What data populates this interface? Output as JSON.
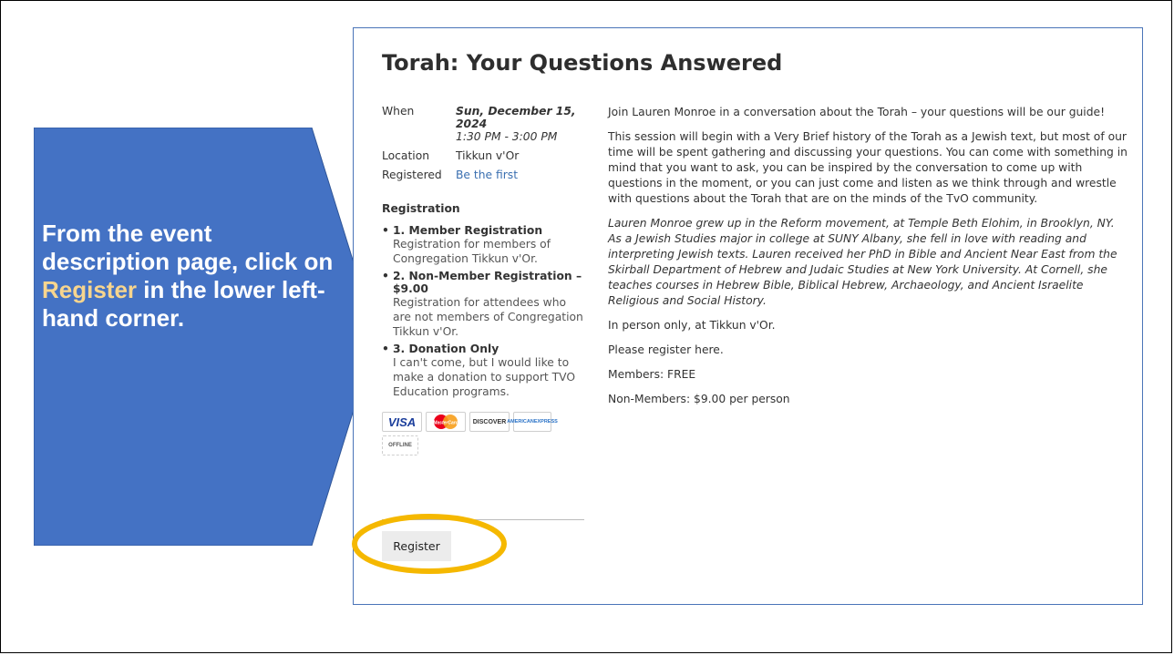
{
  "callout": {
    "line1": "From the event description page, click on ",
    "highlight": "Register",
    "line2": " in the lower left-hand corner."
  },
  "event": {
    "title": "Torah: Your Questions Answered",
    "when_label": "When",
    "when_date": "Sun, December 15, 2024",
    "when_time": "1:30 PM - 3:00 PM",
    "location_label": "Location",
    "location_value": "Tikkun v'Or",
    "registered_label": "Registered",
    "registered_value": "Be the first",
    "registration_heading": "Registration",
    "registration_items": [
      {
        "title": "1. Member Registration",
        "desc": "Registration for members of Congregation Tikkun v'Or."
      },
      {
        "title": "2. Non-Member Registration – $9.00",
        "desc": "Registration for attendees who are not members of Congregation Tikkun v'Or."
      },
      {
        "title": "3. Donation Only",
        "desc": "I can't come, but I would like to make a donation to support TVO Education programs."
      }
    ],
    "payment_icons": [
      "visa-icon",
      "mastercard-icon",
      "discover-icon",
      "american-express-icon",
      "offline-icon"
    ],
    "card_labels": {
      "visa": "VISA",
      "mastercard": "MasterCard",
      "discover": "DISCOVER",
      "amex_1": "AMERICAN",
      "amex_2": "EXPRESS",
      "offline": "OFFLINE"
    },
    "register_button": "Register",
    "description": [
      "Join Lauren Monroe in a conversation about the Torah – your questions will be our guide!",
      "This session will begin with a Very Brief history of the Torah as a Jewish text, but most of our time will be spent gathering and discussing your questions. You can come with something in mind that you want to ask, you can be inspired by the conversation to come up with questions in the moment, or you can just come and listen as we think through and wrestle with questions about the Torah that are on the minds  of the TvO community.",
      "Lauren Monroe grew up in the Reform movement, at Temple Beth Elohim, in Brooklyn, NY.  As a Jewish Studies major in college at SUNY Albany, she fell in love with reading and interpreting Jewish texts. Lauren received her PhD in Bible and Ancient Near East from the Skirball Department of Hebrew and Judaic Studies at New York University. At Cornell, she teaches courses in Hebrew Bible, Biblical Hebrew, Archaeology, and Ancient Israelite Religious and Social History.",
      "In person only, at Tikkun v'Or.",
      "Please register here.",
      "Members:  FREE",
      "Non-Members:  $9.00 per person"
    ]
  },
  "colors": {
    "callout_fill": "#4472c4",
    "callout_highlight": "#f7d58e",
    "ellipse_stroke": "#f5b800",
    "link": "#3a6fb0",
    "page_border": "#4a74b8"
  }
}
